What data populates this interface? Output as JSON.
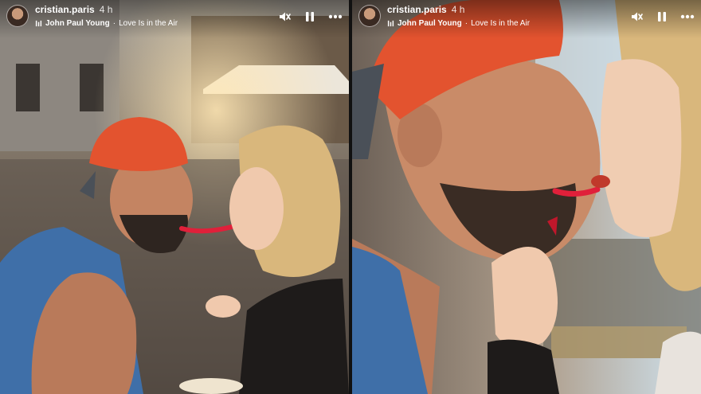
{
  "stories": [
    {
      "username": "cristian.paris",
      "time": "4 h",
      "track_artist": "John Paul Young",
      "track_separator": "·",
      "track_title": "Love Is in the Air",
      "icons": [
        "avatar",
        "music-icon",
        "mute-icon",
        "pause-icon",
        "more-icon"
      ]
    },
    {
      "username": "cristian.paris",
      "time": "4 h",
      "track_artist": "John Paul Young",
      "track_separator": "·",
      "track_title": "Love Is in the Air",
      "icons": [
        "avatar",
        "music-icon",
        "mute-icon",
        "pause-icon",
        "more-icon"
      ]
    }
  ],
  "colors": {
    "cap": "#e3532f",
    "candy": "#e0203a",
    "shirt_blue": "#3f6fa8",
    "hair": "#d9b77c",
    "sky": "#cfe3f0"
  }
}
